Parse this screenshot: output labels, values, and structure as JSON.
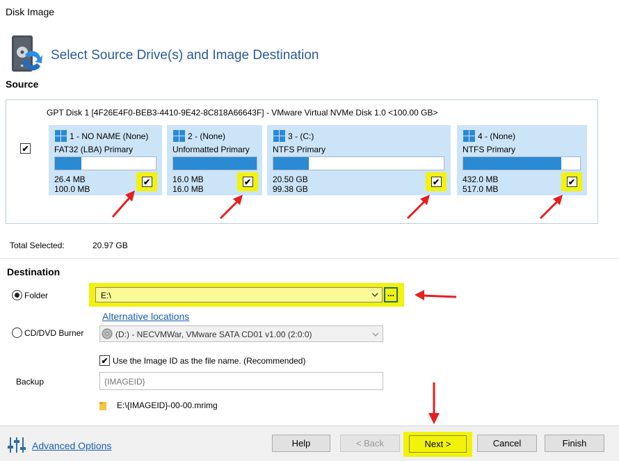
{
  "window": {
    "title": "Disk Image"
  },
  "header": {
    "title": "Select Source Drive(s) and Image Destination"
  },
  "source": {
    "label": "Source",
    "disk_label": "GPT Disk 1 [4F26E4F0-BEB3-4410-9E42-8C818A66643F] - VMware Virtual NVMe Disk 1.0  <100.00 GB>",
    "disk_checked": true,
    "partitions": [
      {
        "title": "1 - NO NAME (None)",
        "type": "FAT32 (LBA) Primary",
        "used": "26.4 MB",
        "total": "100.0 MB",
        "fill_percent": 26,
        "checked": true
      },
      {
        "title": "2 -  (None)",
        "type": "Unformatted Primary",
        "used": "16.0 MB",
        "total": "16.0 MB",
        "fill_percent": 100,
        "checked": true
      },
      {
        "title": "3 -  (C:)",
        "type": "NTFS Primary",
        "used": "20.50 GB",
        "total": "99.38 GB",
        "fill_percent": 21,
        "checked": true
      },
      {
        "title": "4 -  (None)",
        "type": "NTFS Primary",
        "used": "432.0 MB",
        "total": "517.0 MB",
        "fill_percent": 84,
        "checked": true
      }
    ],
    "total_selected_label": "Total Selected:",
    "total_selected_value": "20.97 GB"
  },
  "destination": {
    "label": "Destination",
    "folder_label": "Folder",
    "folder_value": "E:\\",
    "browse_label": "...",
    "alt_locations": "Alternative locations",
    "burner_label": "CD/DVD Burner",
    "burner_value": "(D:) - NECVMWar, VMware SATA CD01 v1.00 (2:0:0)",
    "use_image_id_label": "Use the Image ID as the file name.  (Recommended)",
    "use_image_id_checked": true,
    "backup_label": "Backup",
    "backup_placeholder": "{IMAGEID}",
    "file_path": "E:\\{IMAGEID}-00-00.mrimg"
  },
  "footer": {
    "advanced_options": "Advanced Options",
    "help": "Help",
    "back": "< Back",
    "next": "Next >",
    "cancel": "Cancel",
    "finish": "Finish"
  },
  "colors": {
    "highlight": "#f2f20a",
    "partition_bg": "#cce4f7",
    "bar_fill": "#2a8ad4",
    "arrow": "#e81e1e",
    "link": "#1a5fb4"
  }
}
